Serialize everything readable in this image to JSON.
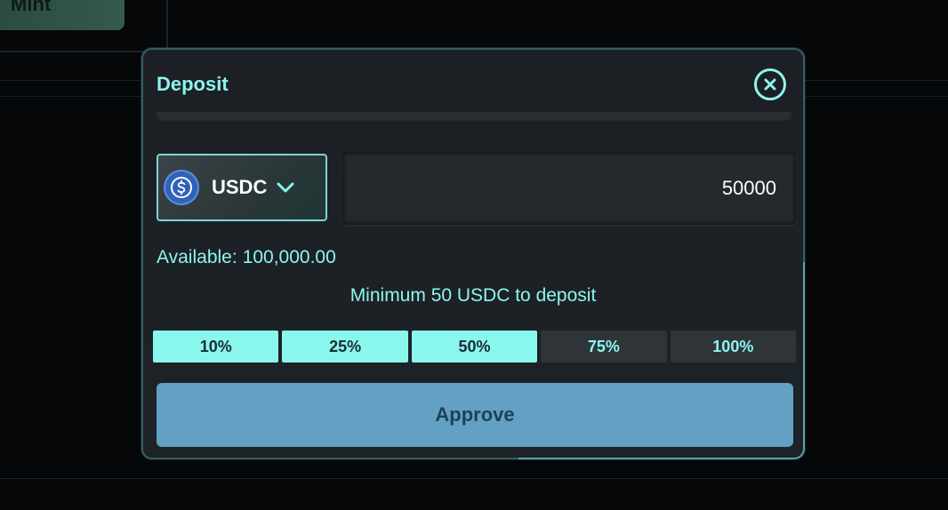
{
  "background": {
    "mint_button_label": "Mint"
  },
  "modal": {
    "title": "Deposit",
    "close_icon": "close-circle-icon",
    "token": {
      "symbol": "USDC",
      "icon": "usdc-coin-icon",
      "dropdown_icon": "chevron-down-icon"
    },
    "amount": {
      "value": "50000",
      "placeholder": "0.00"
    },
    "available": {
      "label": "Available:",
      "value": "100,000.00"
    },
    "minimum_note": "Minimum 50 USDC to deposit",
    "percent_options": [
      {
        "label": "10%",
        "selected": true
      },
      {
        "label": "25%",
        "selected": true
      },
      {
        "label": "50%",
        "selected": true
      },
      {
        "label": "75%",
        "selected": false
      },
      {
        "label": "100%",
        "selected": false
      }
    ],
    "approve_label": "Approve"
  },
  "colors": {
    "accent": "#8cf5ee",
    "modal_bg": "#1c2024",
    "approve_bg": "#62a1c4",
    "approve_text": "#1e4158"
  }
}
